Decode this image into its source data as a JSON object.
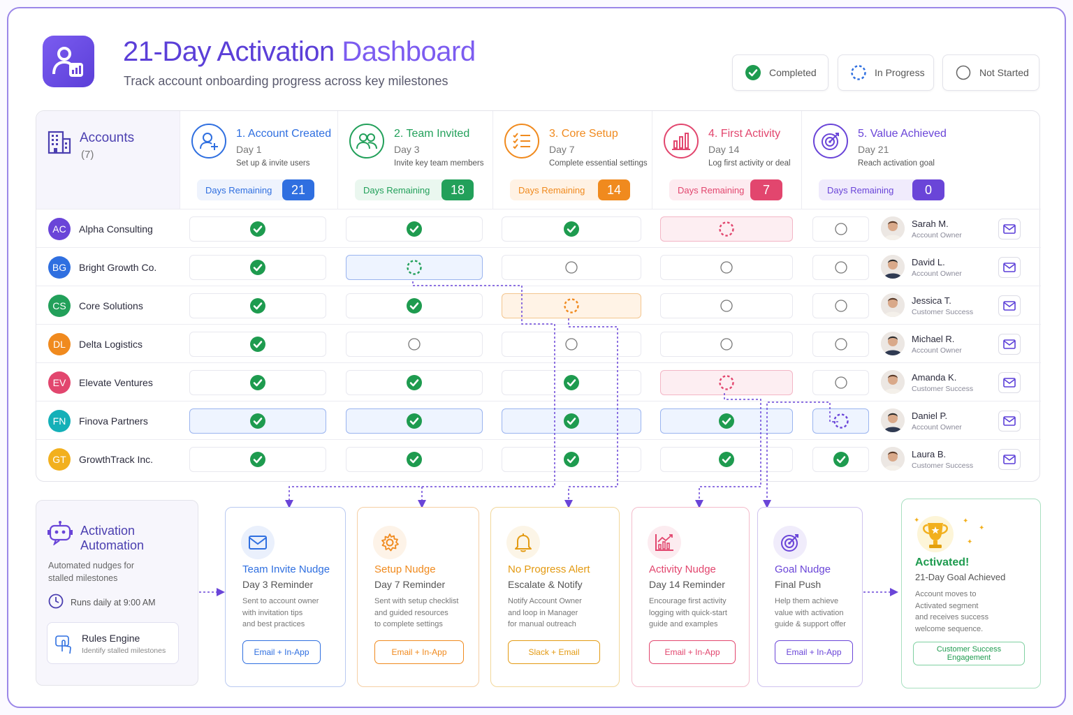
{
  "header": {
    "title_part1": "21-Day Activation",
    "title_part2": "Dashboard",
    "subtitle": "Track account onboarding progress across key milestones"
  },
  "legend": [
    {
      "label": "Completed",
      "icon": "check-circle-icon"
    },
    {
      "label": "In Progress",
      "icon": "dashed-circle-icon"
    },
    {
      "label": "Not Started",
      "icon": "empty-circle-icon"
    }
  ],
  "accounts_header": {
    "title": "Accounts",
    "count": "(7)"
  },
  "milestones": [
    {
      "title": "1. Account Created",
      "day": "Day 1",
      "desc": "Set up & invite users",
      "days_label": "Days Remaining",
      "days": "21",
      "color": "#2f6fe0",
      "bg": "#eef3fd",
      "icon": "add-user-icon"
    },
    {
      "title": "2. Team Invited",
      "day": "Day 3",
      "desc": "Invite key team members",
      "days_label": "Days Remaining",
      "days": "18",
      "color": "#22a05a",
      "bg": "#eaf7ef",
      "icon": "team-icon"
    },
    {
      "title": "3. Core Setup",
      "day": "Day 7",
      "desc": "Complete essential settings",
      "days_label": "Days Remaining",
      "days": "14",
      "color": "#f08a1e",
      "bg": "#fff2e4",
      "icon": "checklist-icon"
    },
    {
      "title": "4. First Activity",
      "day": "Day 14",
      "desc": "Log first activity or deal",
      "days_label": "Days Remaining",
      "days": "7",
      "color": "#e2466e",
      "bg": "#fdebf0",
      "icon": "bar-chart-icon"
    },
    {
      "title": "5. Value Achieved",
      "day": "Day 21",
      "desc": "Reach activation goal",
      "days_label": "Days Remaining",
      "days": "0",
      "color": "#6a45d8",
      "bg": "#f0ebfc",
      "icon": "target-icon"
    }
  ],
  "accounts": [
    {
      "initials": "AC",
      "name": "Alpha Consulting",
      "color": "#6a45d8",
      "status": [
        "done",
        "done",
        "done",
        "prog",
        "none"
      ],
      "owner": "Sarah M.",
      "role": "Account Owner"
    },
    {
      "initials": "BG",
      "name": "Bright Growth Co.",
      "color": "#2f6fe0",
      "status": [
        "done",
        "prog",
        "none",
        "none",
        "none"
      ],
      "owner": "David L.",
      "role": "Account Owner"
    },
    {
      "initials": "CS",
      "name": "Core Solutions",
      "color": "#22a05a",
      "status": [
        "done",
        "done",
        "prog",
        "none",
        "none"
      ],
      "owner": "Jessica T.",
      "role": "Customer Success"
    },
    {
      "initials": "DL",
      "name": "Delta Logistics",
      "color": "#f08a1e",
      "status": [
        "done",
        "none",
        "none",
        "none",
        "none"
      ],
      "owner": "Michael R.",
      "role": "Account Owner"
    },
    {
      "initials": "EV",
      "name": "Elevate Ventures",
      "color": "#e2466e",
      "status": [
        "done",
        "done",
        "done",
        "prog",
        "none"
      ],
      "owner": "Amanda K.",
      "role": "Customer Success"
    },
    {
      "initials": "FN",
      "name": "Finova Partners",
      "color": "#14b0b8",
      "status": [
        "done",
        "done",
        "done",
        "done",
        "prog"
      ],
      "owner": "Daniel P.",
      "role": "Account Owner"
    },
    {
      "initials": "GT",
      "name": "GrowthTrack Inc.",
      "color": "#f2b01e",
      "status": [
        "done",
        "done",
        "done",
        "done",
        "done"
      ],
      "owner": "Laura B.",
      "role": "Customer Success"
    }
  ],
  "automation": {
    "title_line1": "Activation",
    "title_line2": "Automation",
    "desc_line1": "Automated nudges for",
    "desc_line2": "stalled milestones",
    "schedule": "Runs daily at 9:00 AM",
    "rules_title": "Rules Engine",
    "rules_desc": "Identify stalled milestones"
  },
  "nudges": [
    {
      "title": "Team Invite Nudge",
      "sub": "Day 3 Reminder",
      "desc": "Sent to account owner\nwith invitation tips\nand best practices",
      "button": "Email + In-App",
      "color": "#2f6fe0",
      "border": "#b9c9f0",
      "icon": "mail-icon"
    },
    {
      "title": "Setup Nudge",
      "sub": "Day 7 Reminder",
      "desc": "Sent with setup checklist\nand guided resources\nto complete settings",
      "button": "Email + In-App",
      "color": "#f08a1e",
      "border": "#f5cfa4",
      "icon": "settings-gear-icon"
    },
    {
      "title": "No Progress Alert",
      "sub": "Escalate & Notify",
      "desc": "Notify Account Owner\nand loop in Manager\nfor manual outreach",
      "button": "Slack + Email",
      "color": "#e39a12",
      "border": "#f2d79a",
      "icon": "bell-icon"
    },
    {
      "title": "Activity Nudge",
      "sub": "Day 14 Reminder",
      "desc": "Encourage first activity\nlogging with quick-start\nguide and examples",
      "button": "Email + In-App",
      "color": "#e2466e",
      "border": "#f3bccb",
      "icon": "trend-chart-icon"
    },
    {
      "title": "Goal Nudge",
      "sub": "Final Push",
      "desc": "Help them achieve\nvalue with activation\nguide & support offer",
      "button": "Email + In-App",
      "color": "#6a45d8",
      "border": "#cfc3ef",
      "icon": "target-icon"
    }
  ],
  "activated": {
    "title": "Activated!",
    "sub": "21-Day Goal Achieved",
    "desc": "Account moves to\nActivated segment\nand receives success\nwelcome sequence.",
    "button": "Customer Success\nEngagement",
    "icon": "trophy-icon"
  }
}
